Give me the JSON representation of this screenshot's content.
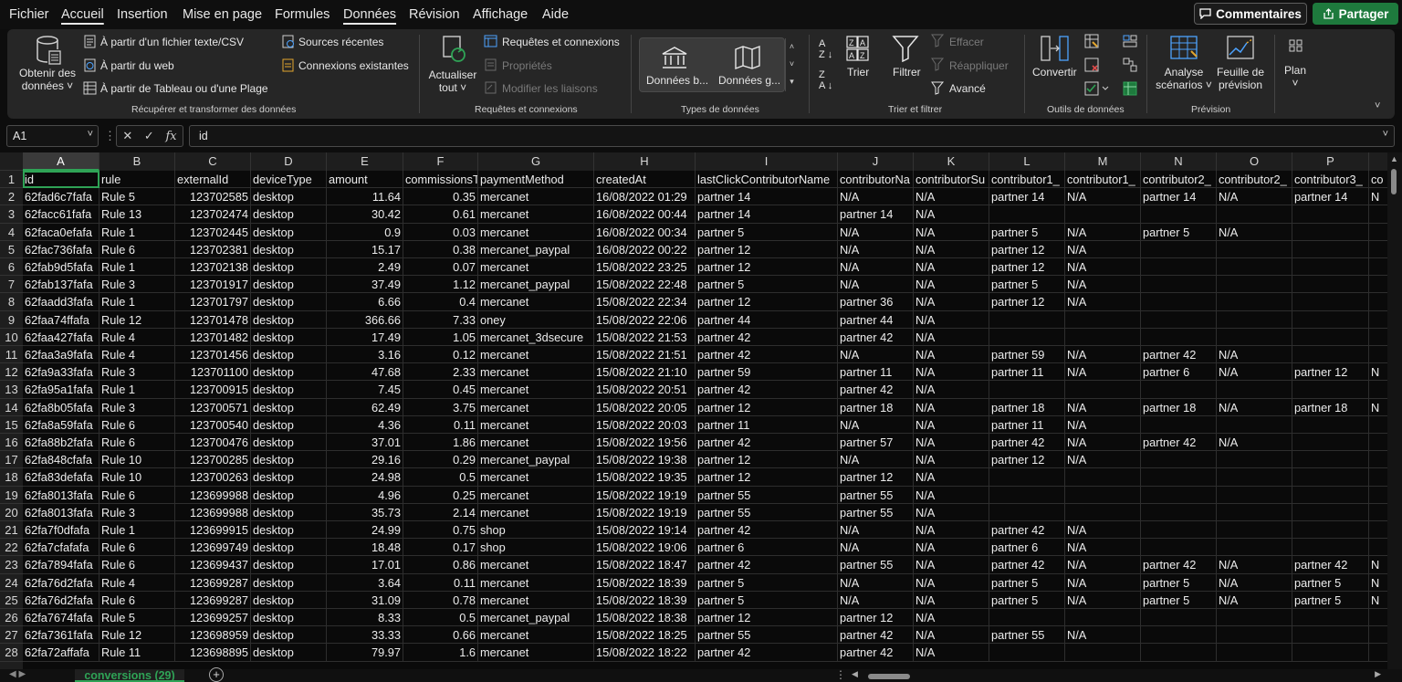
{
  "menu": {
    "items": [
      "Fichier",
      "Accueil",
      "Insertion",
      "Mise en page",
      "Formules",
      "Données",
      "Révision",
      "Affichage",
      "Aide"
    ],
    "active": "Données",
    "comments": "Commentaires",
    "share": "Partager"
  },
  "ribbon": {
    "get_data": "Obtenir des",
    "get_data2": "données",
    "from_text": "À partir d'un fichier texte/CSV",
    "from_web": "À partir du web",
    "from_table": "À partir de Tableau ou d'une Plage",
    "recent": "Sources récentes",
    "existing": "Connexions existantes",
    "group1": "Récupérer et transformer des données",
    "refresh": "Actualiser",
    "refresh2": "tout",
    "queries": "Requêtes et connexions",
    "props": "Propriétés",
    "edit_links": "Modifier les liaisons",
    "group2": "Requêtes et connexions",
    "dt_stocks": "Données b...",
    "dt_geo": "Données g...",
    "group3": "Types de données",
    "sort": "Trier",
    "filter": "Filtrer",
    "clear": "Effacer",
    "reapply": "Réappliquer",
    "advanced": "Avancé",
    "group4": "Trier et filtrer",
    "convert": "Convertir",
    "group5": "Outils de données",
    "whatif": "Analyse",
    "whatif2": "scénarios",
    "forecast": "Feuille de",
    "forecast2": "prévision",
    "group6": "Prévision",
    "outline": "Plan"
  },
  "formula": {
    "cell": "A1",
    "value": "id"
  },
  "columns": [
    "A",
    "B",
    "C",
    "D",
    "E",
    "F",
    "G",
    "H",
    "I",
    "J",
    "K",
    "L",
    "M",
    "N",
    "O",
    "P"
  ],
  "rows": [
    [
      "id",
      "rule",
      "externalId",
      "deviceType",
      "amount",
      "commissionsT",
      "paymentMethod",
      "createdAt",
      "lastClickContributorName",
      "contributorNa",
      "contributorSu",
      "contributor1_",
      "contributor1_",
      "contributor2_",
      "contributor2_",
      "contributor3_",
      "co"
    ],
    [
      "62fad6c7fafa",
      "Rule 5",
      "123702585",
      "desktop",
      "11.64",
      "0.35",
      "mercanet",
      "16/08/2022 01:29",
      "partner 14",
      "N/A",
      "N/A",
      "partner 14",
      "N/A",
      "partner 14",
      "N/A",
      "partner 14",
      "N"
    ],
    [
      "62facc61fafa",
      "Rule 13",
      "123702474",
      "desktop",
      "30.42",
      "0.61",
      "mercanet",
      "16/08/2022 00:44",
      "partner 14",
      "partner 14",
      "N/A",
      "",
      "",
      "",
      "",
      "",
      ""
    ],
    [
      "62faca0efafa",
      "Rule 1",
      "123702445",
      "desktop",
      "0.9",
      "0.03",
      "mercanet",
      "16/08/2022 00:34",
      "partner 5",
      "N/A",
      "N/A",
      "partner 5",
      "N/A",
      "partner 5",
      "N/A",
      "",
      ""
    ],
    [
      "62fac736fafa",
      "Rule 6",
      "123702381",
      "desktop",
      "15.17",
      "0.38",
      "mercanet_paypal",
      "16/08/2022 00:22",
      "partner 12",
      "N/A",
      "N/A",
      "partner 12",
      "N/A",
      "",
      "",
      "",
      ""
    ],
    [
      "62fab9d5fafa",
      "Rule 1",
      "123702138",
      "desktop",
      "2.49",
      "0.07",
      "mercanet",
      "15/08/2022 23:25",
      "partner 12",
      "N/A",
      "N/A",
      "partner 12",
      "N/A",
      "",
      "",
      "",
      ""
    ],
    [
      "62fab137fafa",
      "Rule 3",
      "123701917",
      "desktop",
      "37.49",
      "1.12",
      "mercanet_paypal",
      "15/08/2022 22:48",
      "partner 5",
      "N/A",
      "N/A",
      "partner 5",
      "N/A",
      "",
      "",
      "",
      ""
    ],
    [
      "62faadd3fafa",
      "Rule 1",
      "123701797",
      "desktop",
      "6.66",
      "0.4",
      "mercanet",
      "15/08/2022 22:34",
      "partner 12",
      "partner 36",
      "N/A",
      "partner 12",
      "N/A",
      "",
      "",
      "",
      ""
    ],
    [
      "62faa74ffafa",
      "Rule 12",
      "123701478",
      "desktop",
      "366.66",
      "7.33",
      "oney",
      "15/08/2022 22:06",
      "partner 44",
      "partner 44",
      "N/A",
      "",
      "",
      "",
      "",
      "",
      ""
    ],
    [
      "62faa427fafa",
      "Rule 4",
      "123701482",
      "desktop",
      "17.49",
      "1.05",
      "mercanet_3dsecure",
      "15/08/2022 21:53",
      "partner 42",
      "partner 42",
      "N/A",
      "",
      "",
      "",
      "",
      "",
      ""
    ],
    [
      "62faa3a9fafa",
      "Rule 4",
      "123701456",
      "desktop",
      "3.16",
      "0.12",
      "mercanet",
      "15/08/2022 21:51",
      "partner 42",
      "N/A",
      "N/A",
      "partner 59",
      "N/A",
      "partner 42",
      "N/A",
      "",
      ""
    ],
    [
      "62fa9a33fafa",
      "Rule 3",
      "123701100",
      "desktop",
      "47.68",
      "2.33",
      "mercanet",
      "15/08/2022 21:10",
      "partner 59",
      "partner 11",
      "N/A",
      "partner 11",
      "N/A",
      "partner 6",
      "N/A",
      "partner 12",
      "N"
    ],
    [
      "62fa95a1fafa",
      "Rule 1",
      "123700915",
      "desktop",
      "7.45",
      "0.45",
      "mercanet",
      "15/08/2022 20:51",
      "partner 42",
      "partner 42",
      "N/A",
      "",
      "",
      "",
      "",
      "",
      ""
    ],
    [
      "62fa8b05fafa",
      "Rule 3",
      "123700571",
      "desktop",
      "62.49",
      "3.75",
      "mercanet",
      "15/08/2022 20:05",
      "partner 12",
      "partner 18",
      "N/A",
      "partner 18",
      "N/A",
      "partner 18",
      "N/A",
      "partner 18",
      "N"
    ],
    [
      "62fa8a59fafa",
      "Rule 6",
      "123700540",
      "desktop",
      "4.36",
      "0.11",
      "mercanet",
      "15/08/2022 20:03",
      "partner 11",
      "N/A",
      "N/A",
      "partner 11",
      "N/A",
      "",
      "",
      "",
      ""
    ],
    [
      "62fa88b2fafa",
      "Rule 6",
      "123700476",
      "desktop",
      "37.01",
      "1.86",
      "mercanet",
      "15/08/2022 19:56",
      "partner 42",
      "partner 57",
      "N/A",
      "partner 42",
      "N/A",
      "partner 42",
      "N/A",
      "",
      ""
    ],
    [
      "62fa848cfafa",
      "Rule 10",
      "123700285",
      "desktop",
      "29.16",
      "0.29",
      "mercanet_paypal",
      "15/08/2022 19:38",
      "partner 12",
      "N/A",
      "N/A",
      "partner 12",
      "N/A",
      "",
      "",
      "",
      ""
    ],
    [
      "62fa83defafa",
      "Rule 10",
      "123700263",
      "desktop",
      "24.98",
      "0.5",
      "mercanet",
      "15/08/2022 19:35",
      "partner 12",
      "partner 12",
      "N/A",
      "",
      "",
      "",
      "",
      "",
      ""
    ],
    [
      "62fa8013fafa",
      "Rule 6",
      "123699988",
      "desktop",
      "4.96",
      "0.25",
      "mercanet",
      "15/08/2022 19:19",
      "partner 55",
      "partner 55",
      "N/A",
      "",
      "",
      "",
      "",
      "",
      ""
    ],
    [
      "62fa8013fafa",
      "Rule 3",
      "123699988",
      "desktop",
      "35.73",
      "2.14",
      "mercanet",
      "15/08/2022 19:19",
      "partner 55",
      "partner 55",
      "N/A",
      "",
      "",
      "",
      "",
      "",
      ""
    ],
    [
      "62fa7f0dfafa",
      "Rule 1",
      "123699915",
      "desktop",
      "24.99",
      "0.75",
      "shop",
      "15/08/2022 19:14",
      "partner 42",
      "N/A",
      "N/A",
      "partner 42",
      "N/A",
      "",
      "",
      "",
      ""
    ],
    [
      "62fa7cfafafa",
      "Rule 6",
      "123699749",
      "desktop",
      "18.48",
      "0.17",
      "shop",
      "15/08/2022 19:06",
      "partner 6",
      "N/A",
      "N/A",
      "partner 6",
      "N/A",
      "",
      "",
      "",
      ""
    ],
    [
      "62fa7894fafa",
      "Rule 6",
      "123699437",
      "desktop",
      "17.01",
      "0.86",
      "mercanet",
      "15/08/2022 18:47",
      "partner 42",
      "partner 55",
      "N/A",
      "partner 42",
      "N/A",
      "partner 42",
      "N/A",
      "partner 42",
      "N"
    ],
    [
      "62fa76d2fafa",
      "Rule 4",
      "123699287",
      "desktop",
      "3.64",
      "0.11",
      "mercanet",
      "15/08/2022 18:39",
      "partner 5",
      "N/A",
      "N/A",
      "partner 5",
      "N/A",
      "partner 5",
      "N/A",
      "partner 5",
      "N"
    ],
    [
      "62fa76d2fafa",
      "Rule 6",
      "123699287",
      "desktop",
      "31.09",
      "0.78",
      "mercanet",
      "15/08/2022 18:39",
      "partner 5",
      "N/A",
      "N/A",
      "partner 5",
      "N/A",
      "partner 5",
      "N/A",
      "partner 5",
      "N"
    ],
    [
      "62fa7674fafa",
      "Rule 5",
      "123699257",
      "desktop",
      "8.33",
      "0.5",
      "mercanet_paypal",
      "15/08/2022 18:38",
      "partner 12",
      "partner 12",
      "N/A",
      "",
      "",
      "",
      "",
      "",
      ""
    ],
    [
      "62fa7361fafa",
      "Rule 12",
      "123698959",
      "desktop",
      "33.33",
      "0.66",
      "mercanet",
      "15/08/2022 18:25",
      "partner 55",
      "partner 42",
      "N/A",
      "partner 55",
      "N/A",
      "",
      "",
      "",
      ""
    ],
    [
      "62fa72affafa",
      "Rule 11",
      "123698895",
      "desktop",
      "79.97",
      "1.6",
      "mercanet",
      "15/08/2022 18:22",
      "partner 42",
      "partner 42",
      "N/A",
      "",
      "",
      "",
      "",
      "",
      ""
    ]
  ],
  "sheet": {
    "tab": "conversions (29)",
    "add": "+"
  }
}
